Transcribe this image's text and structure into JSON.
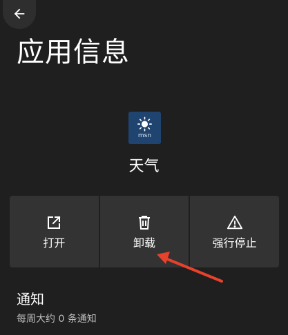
{
  "header": {
    "back_icon": "arrow-left-icon",
    "title": "应用信息"
  },
  "app": {
    "icon_label": "msn",
    "icon_name": "msn-weather-icon",
    "icon_color": "#1f4470",
    "name": "天气"
  },
  "actions": [
    {
      "label": "打开",
      "icon": "open-external-icon"
    },
    {
      "label": "卸载",
      "icon": "trash-icon"
    },
    {
      "label": "强行停止",
      "icon": "warning-icon"
    }
  ],
  "notifications": {
    "title": "通知",
    "summary": "每周大约 0 条通知"
  },
  "colors": {
    "background": "#1f1f1f",
    "button": "#333333",
    "annotation": "#e8412c"
  }
}
